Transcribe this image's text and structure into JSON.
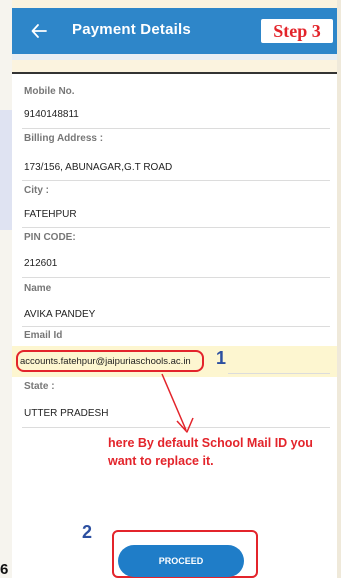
{
  "header": {
    "title": "Payment Details",
    "step": "Step 3"
  },
  "form": {
    "fields": [
      {
        "label": "Mobile No.",
        "value": "9140148811"
      },
      {
        "label": "Billing Address :",
        "value": "173/156, ABUNAGAR,G.T ROAD"
      },
      {
        "label": "City :",
        "value": "FATEHPUR"
      },
      {
        "label": "PIN CODE:",
        "value": "212601"
      },
      {
        "label": "Name",
        "value": "AVIKA PANDEY"
      },
      {
        "label": "Email Id",
        "value": "accounts.fatehpur@jaipuriaschools.ac.in"
      },
      {
        "label": "State :",
        "value": "UTTER PRADESH"
      }
    ],
    "proceed_label": "PROCEED"
  },
  "annotations": {
    "marker_1": "1",
    "marker_2": "2",
    "note": "here By default School Mail ID you want to replace it.",
    "page_number": "6"
  },
  "colors": {
    "header": "#2e86c9",
    "button": "#1f7dc8",
    "annotation_red": "#e3242b",
    "marker_blue": "#2b4fa0"
  },
  "icons": {
    "back": "arrow-left-icon"
  }
}
